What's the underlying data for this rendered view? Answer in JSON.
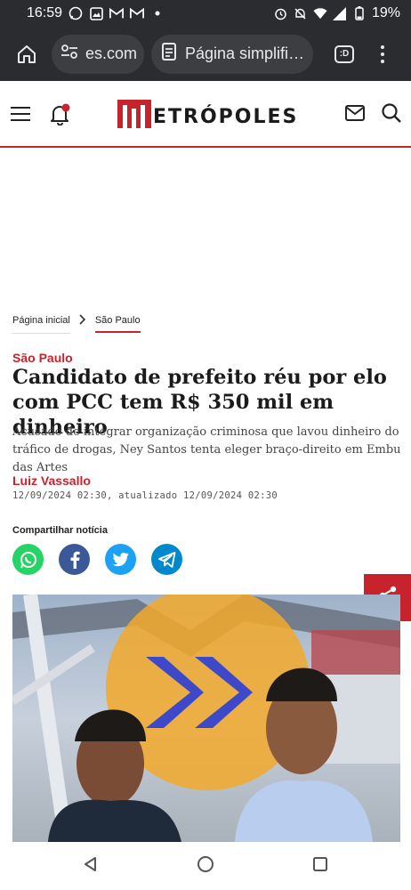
{
  "status_bar": {
    "time": "16:59",
    "battery": "19%",
    "left_icons": [
      "whatsapp-icon",
      "gallery-icon",
      "gmail-icon",
      "gmail-icon",
      "dot-icon"
    ],
    "right_icons": [
      "alarm-icon",
      "mute-icon",
      "wifi-icon",
      "signal-icon",
      "battery-icon"
    ]
  },
  "browser": {
    "url": "es.com",
    "mode_label": "Página simplifi…",
    "tabs_label": ":D"
  },
  "site": {
    "logo_text": "ETRÓPOLES",
    "brand_color": "#c6232c"
  },
  "breadcrumb": {
    "home": "Página inicial",
    "section": "São Paulo"
  },
  "article": {
    "kicker": "São Paulo",
    "headline": "Candidato de prefeito réu por elo com PCC tem R$ 350 mil em dinheiro",
    "dek": "Acusado de integrar organização criminosa que lavou dinheiro do tráfico de drogas, Ney Santos tenta eleger braço-direito em Embu das Artes",
    "author": "Luiz Vassallo",
    "dates": "12/09/2024 02:30, atualizado 12/09/2024 02:30"
  },
  "share": {
    "title": "Compartilhar notícia",
    "networks": [
      {
        "name": "whatsapp-icon",
        "color": "#25d366"
      },
      {
        "name": "facebook-icon",
        "color": "#3b5998"
      },
      {
        "name": "twitter-icon",
        "color": "#1da1f2"
      },
      {
        "name": "telegram-icon",
        "color": "#0088cc"
      }
    ]
  },
  "nav": [
    "back-icon",
    "home-icon",
    "recents-icon"
  ]
}
